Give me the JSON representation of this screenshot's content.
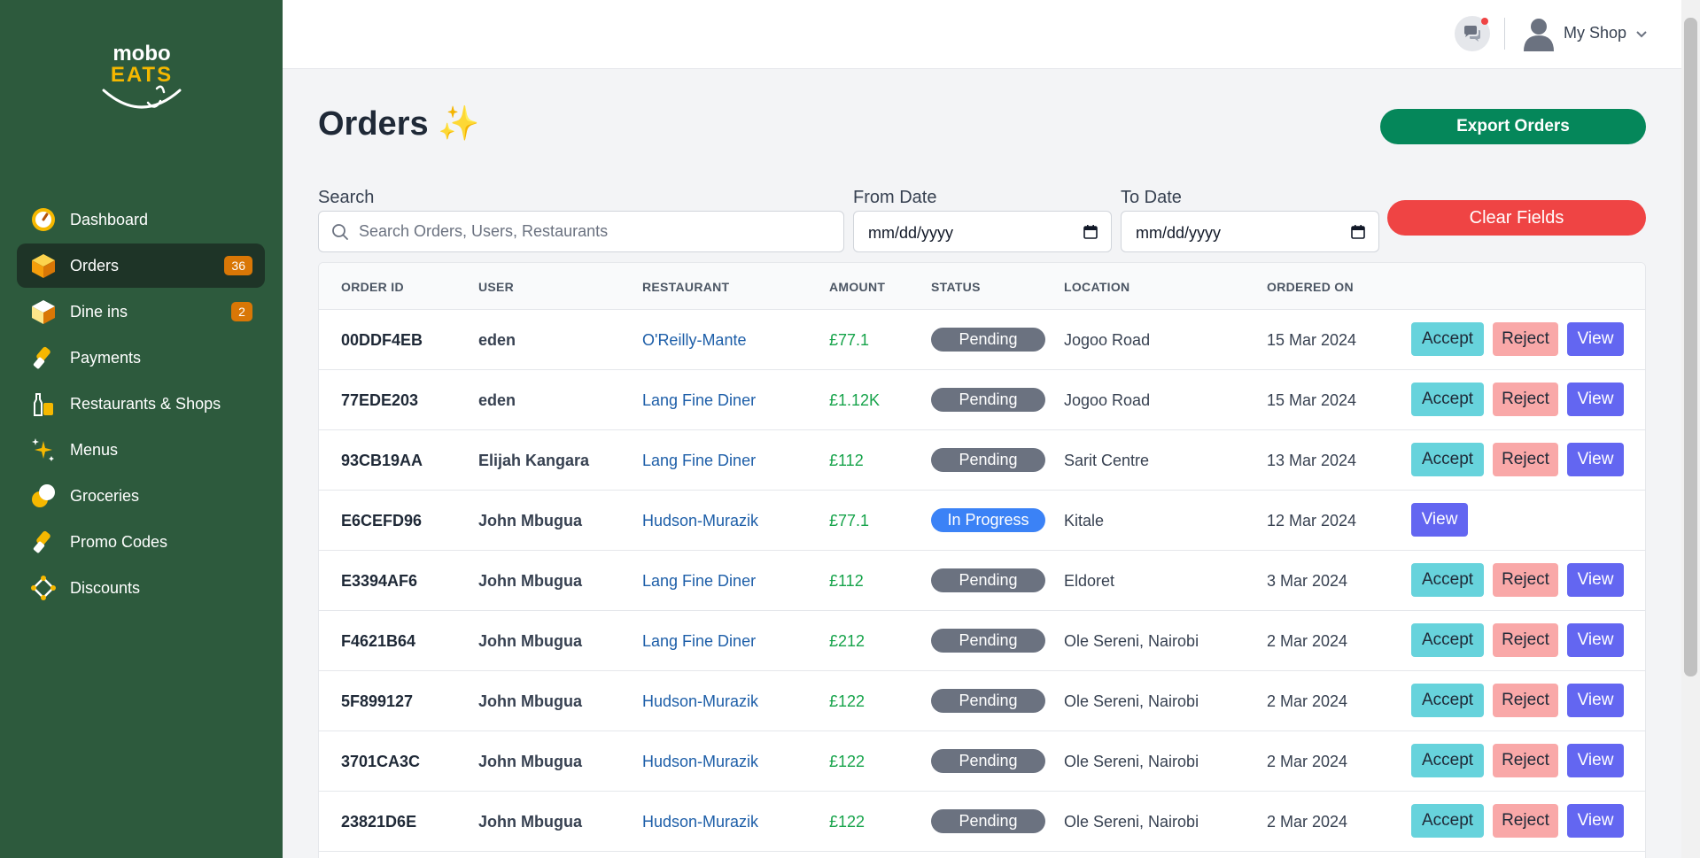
{
  "brand": {
    "line1": "mobo",
    "line2": "EATS"
  },
  "sidebar": {
    "items": [
      {
        "label": "Dashboard",
        "icon": "dashboard-icon",
        "badge": ""
      },
      {
        "label": "Orders",
        "icon": "orders-box-icon",
        "badge": "36",
        "active": true
      },
      {
        "label": "Dine ins",
        "icon": "dine-box-icon",
        "badge": "2"
      },
      {
        "label": "Payments",
        "icon": "payments-icon",
        "badge": ""
      },
      {
        "label": "Restaurants & Shops",
        "icon": "shop-bottle-icon",
        "badge": ""
      },
      {
        "label": "Menus",
        "icon": "sparkles-icon",
        "badge": ""
      },
      {
        "label": "Groceries",
        "icon": "groceries-icon",
        "badge": ""
      },
      {
        "label": "Promo Codes",
        "icon": "promo-icon",
        "badge": ""
      },
      {
        "label": "Discounts",
        "icon": "discounts-icon",
        "badge": ""
      }
    ]
  },
  "topbar": {
    "shop_name": "My Shop"
  },
  "page": {
    "title": "Orders",
    "title_emoji": "✨",
    "export_label": "Export Orders"
  },
  "filters": {
    "search_label": "Search",
    "search_placeholder": "Search Orders, Users, Restaurants",
    "from_label": "From Date",
    "from_value": "mm/dd/yyyy",
    "to_label": "To Date",
    "to_value": "mm/dd/yyyy",
    "clear_label": "Clear Fields"
  },
  "table": {
    "headers": [
      "ORDER ID",
      "USER",
      "RESTAURANT",
      "AMOUNT",
      "STATUS",
      "LOCATION",
      "ORDERED ON"
    ],
    "actions": {
      "accept": "Accept",
      "reject": "Reject",
      "view": "View"
    },
    "rows": [
      {
        "id": "00DDF4EB",
        "user": "eden",
        "restaurant": "O'Reilly-Mante",
        "amount": "£77.1",
        "status": "Pending",
        "location": "Jogoo Road",
        "date": "15 Mar 2024"
      },
      {
        "id": "77EDE203",
        "user": "eden",
        "restaurant": "Lang Fine Diner",
        "amount": "£1.12K",
        "status": "Pending",
        "location": "Jogoo Road",
        "date": "15 Mar 2024"
      },
      {
        "id": "93CB19AA",
        "user": "Elijah Kangara",
        "restaurant": "Lang Fine Diner",
        "amount": "£112",
        "status": "Pending",
        "location": "Sarit Centre",
        "date": "13 Mar 2024"
      },
      {
        "id": "E6CEFD96",
        "user": "John Mbugua",
        "restaurant": "Hudson-Murazik",
        "amount": "£77.1",
        "status": "In Progress",
        "location": "Kitale",
        "date": "12 Mar 2024"
      },
      {
        "id": "E3394AF6",
        "user": "John Mbugua",
        "restaurant": "Lang Fine Diner",
        "amount": "£112",
        "status": "Pending",
        "location": "Eldoret",
        "date": "3 Mar 2024"
      },
      {
        "id": "F4621B64",
        "user": "John Mbugua",
        "restaurant": "Lang Fine Diner",
        "amount": "£212",
        "status": "Pending",
        "location": "Ole Sereni, Nairobi",
        "date": "2 Mar 2024"
      },
      {
        "id": "5F899127",
        "user": "John Mbugua",
        "restaurant": "Hudson-Murazik",
        "amount": "£122",
        "status": "Pending",
        "location": "Ole Sereni, Nairobi",
        "date": "2 Mar 2024"
      },
      {
        "id": "3701CA3C",
        "user": "John Mbugua",
        "restaurant": "Hudson-Murazik",
        "amount": "£122",
        "status": "Pending",
        "location": "Ole Sereni, Nairobi",
        "date": "2 Mar 2024"
      },
      {
        "id": "23821D6E",
        "user": "John Mbugua",
        "restaurant": "Hudson-Murazik",
        "amount": "£122",
        "status": "Pending",
        "location": "Ole Sereni, Nairobi",
        "date": "2 Mar 2024"
      }
    ]
  },
  "colors": {
    "sidebar_bg": "#2d5a3d",
    "accent_yellow": "#f5b800",
    "export_green": "#05875a",
    "clear_red": "#ef4444",
    "view_indigo": "#6366f1",
    "accept_teal": "#67d3dc",
    "reject_pink": "#f9a8a8"
  }
}
